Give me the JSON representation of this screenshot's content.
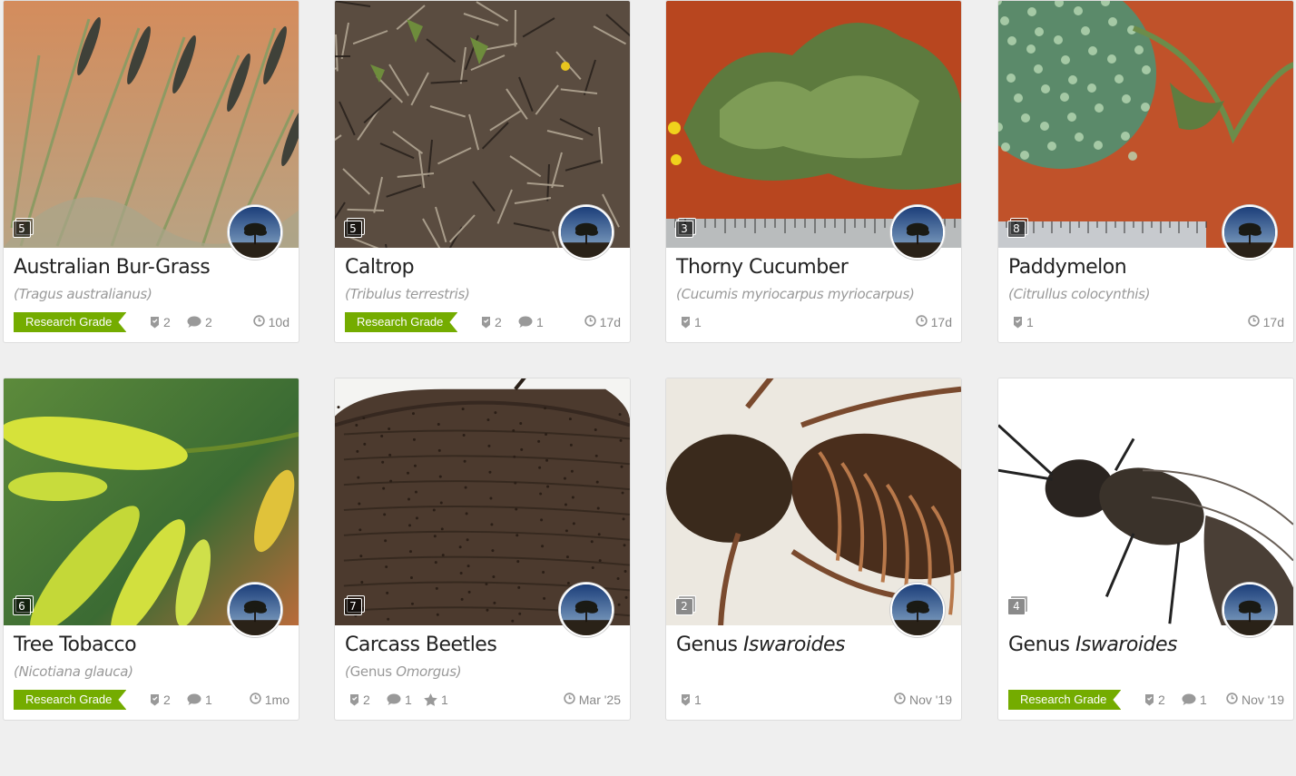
{
  "colors": {
    "research_grade": "#74ac00",
    "meta_text": "#888888",
    "scientific_name": "#999999"
  },
  "cards": [
    {
      "title": "Australian Bur-Grass",
      "scientific": "Tragus australianus",
      "photo_count": "5",
      "badge": "Research Grade",
      "ids": "2",
      "comments": "2",
      "faves": "",
      "date": "10d",
      "photo_subject": "grass-seedheads"
    },
    {
      "title": "Caltrop",
      "scientific": "Tribulus terrestris",
      "photo_count": "5",
      "badge": "Research Grade",
      "ids": "2",
      "comments": "1",
      "faves": "",
      "date": "17d",
      "photo_subject": "ground-litter"
    },
    {
      "title": "Thorny Cucumber",
      "scientific": "Cucumis myriocarpus myriocarpus",
      "photo_count": "3",
      "badge": "",
      "ids": "1",
      "comments": "",
      "faves": "",
      "date": "17d",
      "photo_subject": "leafy-plant-ruler"
    },
    {
      "title": "Paddymelon",
      "scientific": "Citrullus colocynthis",
      "photo_count": "8",
      "badge": "",
      "ids": "1",
      "comments": "",
      "faves": "",
      "date": "17d",
      "photo_subject": "melon-ruler"
    },
    {
      "title": "Tree Tobacco",
      "scientific": "Nicotiana glauca",
      "photo_count": "6",
      "badge": "Research Grade",
      "ids": "2",
      "comments": "1",
      "faves": "",
      "date": "1mo",
      "photo_subject": "yellow-flowers"
    },
    {
      "title": "Carcass Beetles",
      "scientific_prefix": "Genus ",
      "scientific": "Omorgus",
      "photo_count": "7",
      "badge": "",
      "ids": "2",
      "comments": "1",
      "faves": "1",
      "date": "Mar '25",
      "photo_subject": "beetle"
    },
    {
      "title_prefix": "Genus ",
      "title": "Iswaroides",
      "scientific": "",
      "photo_count": "2",
      "badge": "",
      "ids": "1",
      "comments": "",
      "faves": "",
      "date": "Nov '19",
      "photo_subject": "insect-close"
    },
    {
      "title_prefix": "Genus ",
      "title": "Iswaroides",
      "scientific": "",
      "photo_count": "4",
      "badge": "Research Grade",
      "ids": "2",
      "comments": "1",
      "faves": "",
      "date": "Nov '19",
      "photo_subject": "wasp"
    }
  ],
  "icons": {
    "ids": "identification-icon",
    "comments": "comment-icon",
    "faves": "star-icon",
    "date": "clock-icon"
  }
}
